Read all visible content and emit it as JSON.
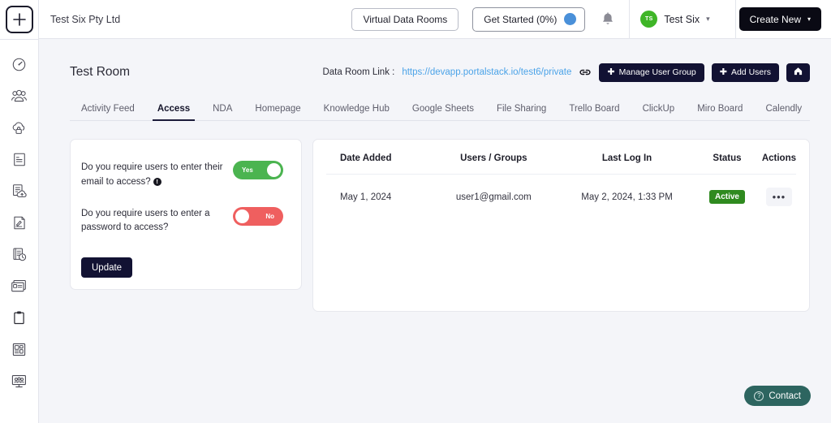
{
  "app": {
    "logo_icon": "plus-icon",
    "org_name": "Test Six Pty Ltd"
  },
  "sidebar": {
    "items": [
      {
        "icon": "dashboard-gauge-icon",
        "name": "sidebar-item-dashboard"
      },
      {
        "icon": "users-group-icon",
        "name": "sidebar-item-users"
      },
      {
        "icon": "cloud-lock-icon",
        "name": "sidebar-item-secure-cloud"
      },
      {
        "icon": "document-list-icon",
        "name": "sidebar-item-documents"
      },
      {
        "icon": "document-upload-cloud-icon",
        "name": "sidebar-item-upload"
      },
      {
        "icon": "document-signature-icon",
        "name": "sidebar-item-signature"
      },
      {
        "icon": "notebook-clock-icon",
        "name": "sidebar-item-history"
      },
      {
        "icon": "window-card-icon",
        "name": "sidebar-item-pages"
      },
      {
        "icon": "clipboard-icon",
        "name": "sidebar-item-tasks"
      },
      {
        "icon": "layout-grid-icon",
        "name": "sidebar-item-layouts"
      },
      {
        "icon": "monitor-people-icon",
        "name": "sidebar-item-meetings"
      }
    ]
  },
  "topbar": {
    "virtual_data_rooms": "Virtual Data Rooms",
    "get_started": "Get Started (0%)",
    "get_started_dot_color": "#4a90d9",
    "bell_icon": "notification-bell-icon",
    "avatar_initials": "TS",
    "avatar_color": "#3fb527",
    "user_name": "Test Six",
    "user_caret": "▾",
    "create_new": "Create New",
    "create_new_caret": "▾"
  },
  "page": {
    "title": "Test Room",
    "link_label": "Data Room Link :",
    "link_url": "https://devapp.portalstack.io/test6/private",
    "link_icon": "chain-link-icon",
    "manage_user_group": "Manage User Group",
    "add_users": "Add Users",
    "home_icon": "home-icon",
    "plus_glyph": "✚"
  },
  "tabs": [
    {
      "label": "Activity Feed",
      "active": false
    },
    {
      "label": "Access",
      "active": true
    },
    {
      "label": "NDA",
      "active": false
    },
    {
      "label": "Homepage",
      "active": false
    },
    {
      "label": "Knowledge Hub",
      "active": false
    },
    {
      "label": "Google Sheets",
      "active": false
    },
    {
      "label": "File Sharing",
      "active": false
    },
    {
      "label": "Trello Board",
      "active": false
    },
    {
      "label": "ClickUp",
      "active": false
    },
    {
      "label": "Miro Board",
      "active": false
    },
    {
      "label": "Calendly",
      "active": false
    }
  ],
  "settings": {
    "email_question": "Do you require users to enter their email to access?",
    "email_info_glyph": "!",
    "email_toggle_value": "Yes",
    "email_toggle_on": true,
    "email_toggle_color": "#4bb450",
    "password_question": "Do you require users to enter a password to access?",
    "password_toggle_value": "No",
    "password_toggle_on": false,
    "password_toggle_color": "#ef5f5f",
    "update_label": "Update"
  },
  "table": {
    "columns": [
      "Date Added",
      "Users / Groups",
      "Last Log In",
      "Status",
      "Actions"
    ],
    "rows": [
      {
        "date_added": "May 1, 2024",
        "user": "user1@gmail.com",
        "last_login": "May 2, 2024, 1:33 PM",
        "status": "Active",
        "status_color": "#2f8a1f",
        "actions_glyph": "•••"
      }
    ]
  },
  "contact": {
    "label": "Contact",
    "icon": "question-mark-icon",
    "glyph": "?",
    "color": "#2d6560"
  }
}
